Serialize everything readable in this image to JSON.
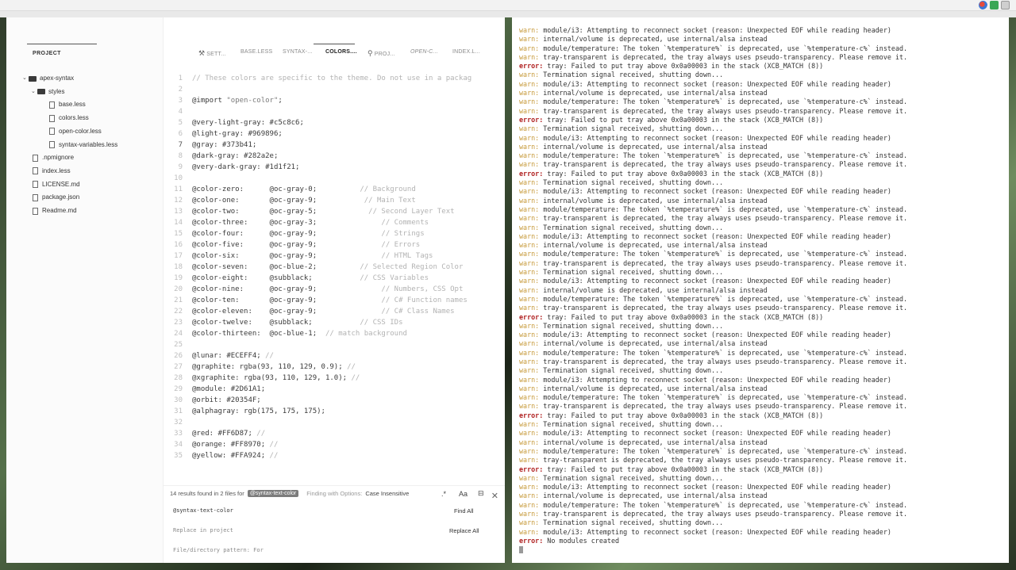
{
  "tray_icons": [
    "chrome-icon",
    "checkmark-icon",
    "window-icon"
  ],
  "project": {
    "title": "PROJECT",
    "tree": [
      {
        "label": "apex-syntax",
        "type": "folder",
        "depth": 0,
        "expanded": true
      },
      {
        "label": "styles",
        "type": "folder",
        "depth": 1,
        "expanded": true
      },
      {
        "label": "base.less",
        "type": "file",
        "depth": 2
      },
      {
        "label": "colors.less",
        "type": "file",
        "depth": 2
      },
      {
        "label": "open-color.less",
        "type": "file",
        "depth": 2
      },
      {
        "label": "syntax-variables.less",
        "type": "file",
        "depth": 2
      },
      {
        "label": ".npmignore",
        "type": "file",
        "depth": 1
      },
      {
        "label": "index.less",
        "type": "file",
        "depth": 1
      },
      {
        "label": "LICENSE.md",
        "type": "file",
        "depth": 1
      },
      {
        "label": "package.json",
        "type": "file",
        "depth": 1
      },
      {
        "label": "Readme.md",
        "type": "file",
        "depth": 1
      }
    ]
  },
  "tabs": [
    {
      "label": "SETT...",
      "icon": "settings-icon",
      "active": false,
      "italic": false
    },
    {
      "label": "BASE.LESS",
      "icon": "",
      "active": false,
      "italic": false
    },
    {
      "label": "SYNTAX-...",
      "icon": "",
      "active": false,
      "italic": false
    },
    {
      "label": "COLORS....",
      "icon": "",
      "active": true,
      "italic": false
    },
    {
      "label": "PROJ...",
      "icon": "search-icon",
      "active": false,
      "italic": false
    },
    {
      "label": "OPEN-C...",
      "icon": "",
      "active": false,
      "italic": true
    },
    {
      "label": "INDEX.L...",
      "icon": "",
      "active": false,
      "italic": false
    }
  ],
  "code": {
    "current_line": 7,
    "lines": [
      {
        "n": "1",
        "text": "",
        "comment": "// These colors are specific to the theme. Do not use in a packag"
      },
      {
        "n": "2",
        "text": "",
        "comment": ""
      },
      {
        "n": "3",
        "text": "@import ",
        "string": "\"open-color\"",
        "tail": ";",
        "comment": ""
      },
      {
        "n": "4",
        "text": "",
        "comment": ""
      },
      {
        "n": "5",
        "text": "@very-light-gray: #c5c8c6;",
        "comment": ""
      },
      {
        "n": "6",
        "text": "@light-gray: #969896;",
        "comment": ""
      },
      {
        "n": "7",
        "text": "@gray: #373b41;",
        "comment": ""
      },
      {
        "n": "8",
        "text": "@dark-gray: #282a2e;",
        "comment": ""
      },
      {
        "n": "9",
        "text": "@very-dark-gray: #1d1f21;",
        "comment": ""
      },
      {
        "n": "10",
        "text": "",
        "comment": ""
      },
      {
        "n": "11",
        "text": "@color-zero:      @oc-gray-0;          ",
        "comment": "// Background"
      },
      {
        "n": "12",
        "text": "@color-one:       @oc-gray-9;           ",
        "comment": "// Main Text"
      },
      {
        "n": "13",
        "text": "@color-two:       @oc-gray-5;            ",
        "comment": "// Second Layer Text"
      },
      {
        "n": "14",
        "text": "@color-three:     @oc-gray-3;               ",
        "comment": "// Comments"
      },
      {
        "n": "15",
        "text": "@color-four:      @oc-gray-9;               ",
        "comment": "// Strings"
      },
      {
        "n": "16",
        "text": "@color-five:      @oc-gray-9;               ",
        "comment": "// Errors"
      },
      {
        "n": "17",
        "text": "@color-six:       @oc-gray-9;               ",
        "comment": "// HTML Tags"
      },
      {
        "n": "18",
        "text": "@color-seven:     @oc-blue-2;          ",
        "comment": "// Selected Region Color"
      },
      {
        "n": "19",
        "text": "@color-eight:     @subblack;           ",
        "comment": "// CSS Variables"
      },
      {
        "n": "20",
        "text": "@color-nine:      @oc-gray-9;               ",
        "comment": "// Numbers, CSS Opt"
      },
      {
        "n": "21",
        "text": "@color-ten:       @oc-gray-9;               ",
        "comment": "// C# Function names"
      },
      {
        "n": "22",
        "text": "@color-eleven:    @oc-gray-9;               ",
        "comment": "// C# Class Names"
      },
      {
        "n": "23",
        "text": "@color-twelve:    @subblack;           ",
        "comment": "// CSS IDs"
      },
      {
        "n": "24",
        "text": "@color-thirteen:  @oc-blue-1;  ",
        "comment": "// match background"
      },
      {
        "n": "25",
        "text": "",
        "comment": ""
      },
      {
        "n": "26",
        "text": "@lunar: #ECEFF4; ",
        "comment": "//"
      },
      {
        "n": "27",
        "text": "@graphite: rgba(93, 110, 129, 0.9); ",
        "comment": "//"
      },
      {
        "n": "28",
        "text": "@xgraphite: rgba(93, 110, 129, 1.0); ",
        "comment": "//"
      },
      {
        "n": "29",
        "text": "@module: #2D61A1;",
        "comment": ""
      },
      {
        "n": "30",
        "text": "@orbit: #20354F;",
        "comment": ""
      },
      {
        "n": "31",
        "text": "@alphagray: rgb(175, 175, 175);",
        "comment": ""
      },
      {
        "n": "32",
        "text": "",
        "comment": ""
      },
      {
        "n": "33",
        "text": "@red: #FF6D87; ",
        "comment": "//"
      },
      {
        "n": "34",
        "text": "@orange: #FF8970; ",
        "comment": "//"
      },
      {
        "n": "35",
        "text": "@yellow: #FFA924; ",
        "comment": "//"
      }
    ]
  },
  "find": {
    "summary_prefix": "14 results found in 2 files for",
    "summary_pattern": "@syntax-text-color",
    "options_label": "Finding with Options:",
    "options_value": "Case Insensitive",
    "regex_label": ".*",
    "case_label": "Aa",
    "word_label": "⊟",
    "close_label": "✕",
    "search_value": "@syntax-text-color",
    "find_all": "Find All",
    "replace_placeholder": "Replace in project",
    "replace_all": "Replace All",
    "pattern_placeholder": "File/directory pattern: For"
  },
  "terminal": {
    "lines": [
      {
        "level": "warn",
        "msg": "module/i3: Attempting to reconnect socket (reason: Unexpected EOF while reading header)"
      },
      {
        "level": "warn",
        "msg": "internal/volume is deprecated, use internal/alsa instead"
      },
      {
        "level": "warn",
        "msg": "module/temperature: The token `%temperature%` is deprecated, use `%temperature-c%` instead."
      },
      {
        "level": "warn",
        "msg": "tray-transparent is deprecated, the tray always uses pseudo-transparency. Please remove it."
      },
      {
        "level": "error",
        "msg": "tray: Failed to put tray above 0x0a00003 in the stack (XCB_MATCH (8))"
      },
      {
        "level": "warn",
        "msg": "Termination signal received, shutting down..."
      },
      {
        "level": "warn",
        "msg": "module/i3: Attempting to reconnect socket (reason: Unexpected EOF while reading header)"
      },
      {
        "level": "warn",
        "msg": "internal/volume is deprecated, use internal/alsa instead"
      },
      {
        "level": "warn",
        "msg": "module/temperature: The token `%temperature%` is deprecated, use `%temperature-c%` instead."
      },
      {
        "level": "warn",
        "msg": "tray-transparent is deprecated, the tray always uses pseudo-transparency. Please remove it."
      },
      {
        "level": "error",
        "msg": "tray: Failed to put tray above 0x0a00003 in the stack (XCB_MATCH (8))"
      },
      {
        "level": "warn",
        "msg": "Termination signal received, shutting down..."
      },
      {
        "level": "warn",
        "msg": "module/i3: Attempting to reconnect socket (reason: Unexpected EOF while reading header)"
      },
      {
        "level": "warn",
        "msg": "internal/volume is deprecated, use internal/alsa instead"
      },
      {
        "level": "warn",
        "msg": "module/temperature: The token `%temperature%` is deprecated, use `%temperature-c%` instead."
      },
      {
        "level": "warn",
        "msg": "tray-transparent is deprecated, the tray always uses pseudo-transparency. Please remove it."
      },
      {
        "level": "error",
        "msg": "tray: Failed to put tray above 0x0a00003 in the stack (XCB_MATCH (8))"
      },
      {
        "level": "warn",
        "msg": "Termination signal received, shutting down..."
      },
      {
        "level": "warn",
        "msg": "module/i3: Attempting to reconnect socket (reason: Unexpected EOF while reading header)"
      },
      {
        "level": "warn",
        "msg": "internal/volume is deprecated, use internal/alsa instead"
      },
      {
        "level": "warn",
        "msg": "module/temperature: The token `%temperature%` is deprecated, use `%temperature-c%` instead."
      },
      {
        "level": "warn",
        "msg": "tray-transparent is deprecated, the tray always uses pseudo-transparency. Please remove it."
      },
      {
        "level": "warn",
        "msg": "Termination signal received, shutting down..."
      },
      {
        "level": "warn",
        "msg": "module/i3: Attempting to reconnect socket (reason: Unexpected EOF while reading header)"
      },
      {
        "level": "warn",
        "msg": "internal/volume is deprecated, use internal/alsa instead"
      },
      {
        "level": "warn",
        "msg": "module/temperature: The token `%temperature%` is deprecated, use `%temperature-c%` instead."
      },
      {
        "level": "warn",
        "msg": "tray-transparent is deprecated, the tray always uses pseudo-transparency. Please remove it."
      },
      {
        "level": "warn",
        "msg": "Termination signal received, shutting down..."
      },
      {
        "level": "warn",
        "msg": "module/i3: Attempting to reconnect socket (reason: Unexpected EOF while reading header)"
      },
      {
        "level": "warn",
        "msg": "internal/volume is deprecated, use internal/alsa instead"
      },
      {
        "level": "warn",
        "msg": "module/temperature: The token `%temperature%` is deprecated, use `%temperature-c%` instead."
      },
      {
        "level": "warn",
        "msg": "tray-transparent is deprecated, the tray always uses pseudo-transparency. Please remove it."
      },
      {
        "level": "error",
        "msg": "tray: Failed to put tray above 0x0a00003 in the stack (XCB_MATCH (8))"
      },
      {
        "level": "warn",
        "msg": "Termination signal received, shutting down..."
      },
      {
        "level": "warn",
        "msg": "module/i3: Attempting to reconnect socket (reason: Unexpected EOF while reading header)"
      },
      {
        "level": "warn",
        "msg": "internal/volume is deprecated, use internal/alsa instead"
      },
      {
        "level": "warn",
        "msg": "module/temperature: The token `%temperature%` is deprecated, use `%temperature-c%` instead."
      },
      {
        "level": "warn",
        "msg": "tray-transparent is deprecated, the tray always uses pseudo-transparency. Please remove it."
      },
      {
        "level": "warn",
        "msg": "Termination signal received, shutting down..."
      },
      {
        "level": "warn",
        "msg": "module/i3: Attempting to reconnect socket (reason: Unexpected EOF while reading header)"
      },
      {
        "level": "warn",
        "msg": "internal/volume is deprecated, use internal/alsa instead"
      },
      {
        "level": "warn",
        "msg": "module/temperature: The token `%temperature%` is deprecated, use `%temperature-c%` instead."
      },
      {
        "level": "warn",
        "msg": "tray-transparent is deprecated, the tray always uses pseudo-transparency. Please remove it."
      },
      {
        "level": "error",
        "msg": "tray: Failed to put tray above 0x0a00003 in the stack (XCB_MATCH (8))"
      },
      {
        "level": "warn",
        "msg": "Termination signal received, shutting down..."
      },
      {
        "level": "warn",
        "msg": "module/i3: Attempting to reconnect socket (reason: Unexpected EOF while reading header)"
      },
      {
        "level": "warn",
        "msg": "internal/volume is deprecated, use internal/alsa instead"
      },
      {
        "level": "warn",
        "msg": "module/temperature: The token `%temperature%` is deprecated, use `%temperature-c%` instead."
      },
      {
        "level": "warn",
        "msg": "tray-transparent is deprecated, the tray always uses pseudo-transparency. Please remove it."
      },
      {
        "level": "error",
        "msg": "tray: Failed to put tray above 0x0a00003 in the stack (XCB_MATCH (8))"
      },
      {
        "level": "warn",
        "msg": "Termination signal received, shutting down..."
      },
      {
        "level": "warn",
        "msg": "module/i3: Attempting to reconnect socket (reason: Unexpected EOF while reading header)"
      },
      {
        "level": "warn",
        "msg": "internal/volume is deprecated, use internal/alsa instead"
      },
      {
        "level": "warn",
        "msg": "module/temperature: The token `%temperature%` is deprecated, use `%temperature-c%` instead."
      },
      {
        "level": "warn",
        "msg": "tray-transparent is deprecated, the tray always uses pseudo-transparency. Please remove it."
      },
      {
        "level": "warn",
        "msg": "Termination signal received, shutting down..."
      },
      {
        "level": "warn",
        "msg": "module/i3: Attempting to reconnect socket (reason: Unexpected EOF while reading header)"
      },
      {
        "level": "error",
        "msg": "No modules created"
      }
    ]
  }
}
